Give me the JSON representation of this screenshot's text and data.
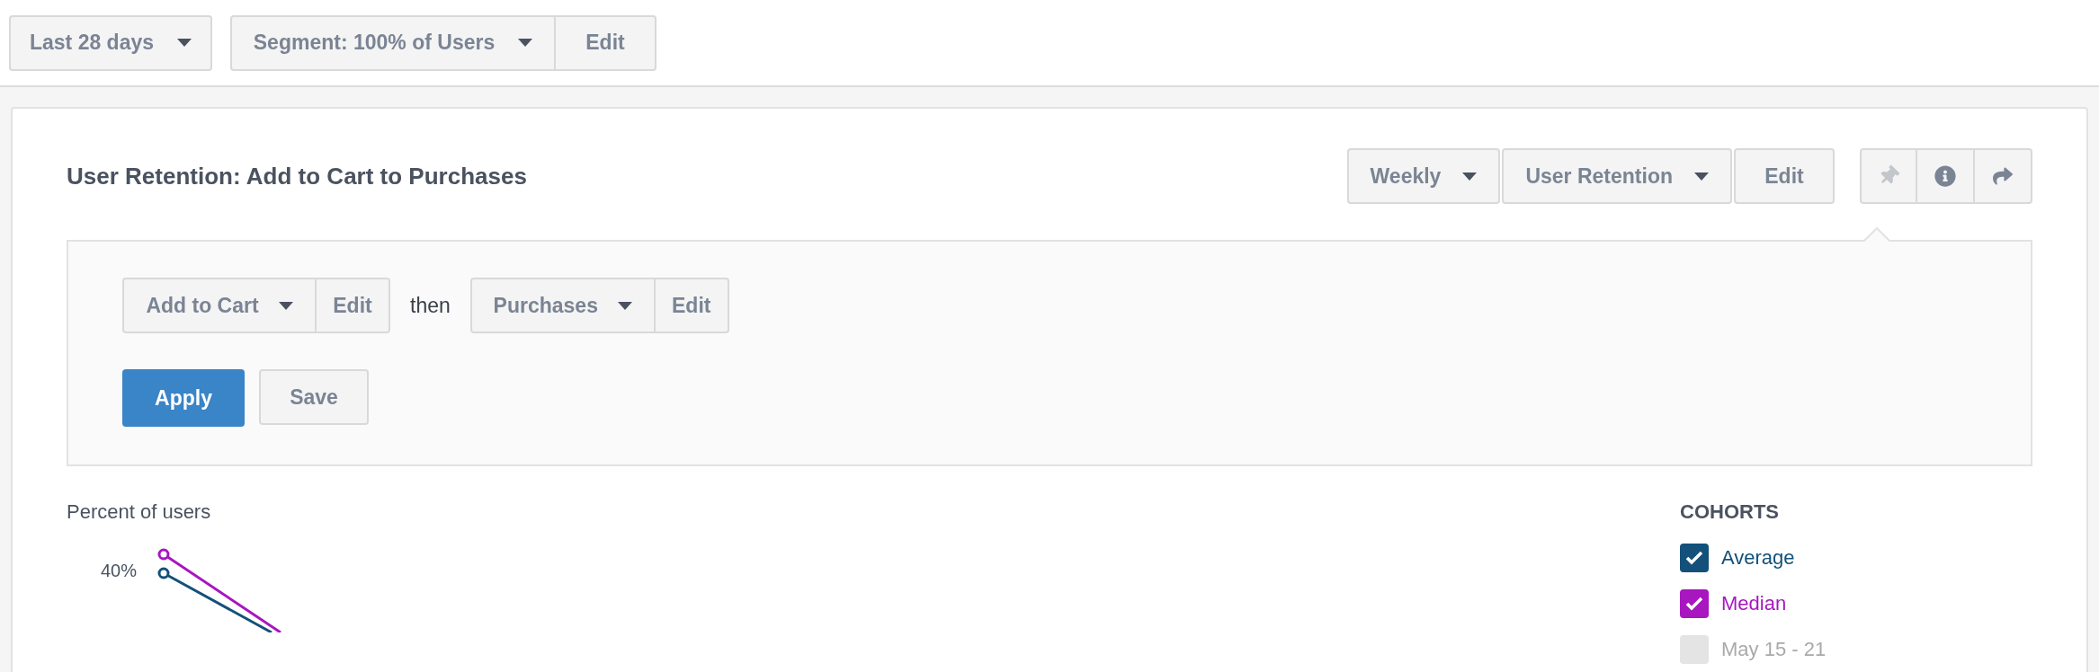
{
  "toolbar": {
    "date_range": "Last 28 days",
    "segment": "Segment: 100% of Users",
    "segment_edit": "Edit"
  },
  "report": {
    "title": "User Retention: Add to Cart to Purchases",
    "controls": [
      {
        "label": "Weekly",
        "kind": "dropdown"
      },
      {
        "label": "User Retention",
        "kind": "dropdown"
      },
      {
        "label": "Edit",
        "kind": "plain"
      }
    ],
    "icon_buttons": [
      {
        "kind": "pin",
        "disabled": true
      },
      {
        "kind": "info",
        "disabled": false
      },
      {
        "kind": "share",
        "disabled": false
      }
    ],
    "query": {
      "first_event": "Add to Cart",
      "first_edit": "Edit",
      "connector": "then",
      "second_event": "Purchases",
      "second_edit": "Edit",
      "apply": "Apply",
      "save": "Save"
    },
    "chart": {
      "ylabel": "Percent of users",
      "tick": "40%"
    },
    "cohorts": {
      "title": "COHORTS",
      "items": [
        {
          "label": "Average",
          "checked": true,
          "color": "#13507a"
        },
        {
          "label": "Median",
          "checked": true,
          "color": "#a716bf"
        },
        {
          "label": "May 15 - 21",
          "checked": false
        }
      ]
    }
  }
}
